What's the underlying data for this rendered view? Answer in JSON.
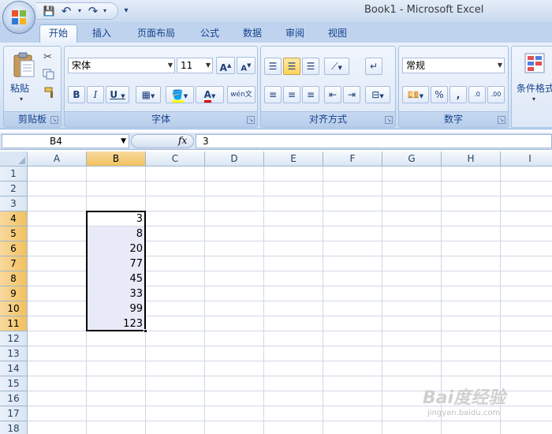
{
  "title_bar": {
    "title": "Book1 - Microsoft Excel"
  },
  "quick_access": {
    "save": "💾",
    "undo": "↶",
    "redo": "↷",
    "more": "▾"
  },
  "tabs": [
    {
      "label": "开始"
    },
    {
      "label": "插入"
    },
    {
      "label": "页面布局"
    },
    {
      "label": "公式"
    },
    {
      "label": "数据"
    },
    {
      "label": "审阅"
    },
    {
      "label": "视图"
    }
  ],
  "ribbon": {
    "clipboard": {
      "paste": "粘贴",
      "label": "剪贴板"
    },
    "font": {
      "name": "宋体",
      "size": "11",
      "bold": "B",
      "italic": "I",
      "underline": "U",
      "label": "字体"
    },
    "alignment": {
      "label": "对齐方式"
    },
    "number": {
      "format": "常规",
      "percent": "%",
      "comma": ",",
      "label": "数字"
    },
    "styles": {
      "conditional": "条件格式"
    }
  },
  "formula_bar": {
    "name_box": "B4",
    "fx": "fx",
    "value": "3"
  },
  "grid": {
    "columns": [
      "A",
      "B",
      "C",
      "D",
      "E",
      "F",
      "G",
      "H",
      "I"
    ],
    "rows": [
      "1",
      "2",
      "3",
      "4",
      "5",
      "6",
      "7",
      "8",
      "9",
      "10",
      "11",
      "12",
      "13",
      "14",
      "15",
      "16",
      "17",
      "18"
    ],
    "selected_column": "B",
    "selected_rows": [
      "4",
      "5",
      "6",
      "7",
      "8",
      "9",
      "10",
      "11"
    ],
    "b_values": [
      "3",
      "8",
      "20",
      "77",
      "45",
      "33",
      "99",
      "123"
    ]
  },
  "watermark": {
    "text": "Bai度经验",
    "sub": "jingyan.baidu.com"
  }
}
